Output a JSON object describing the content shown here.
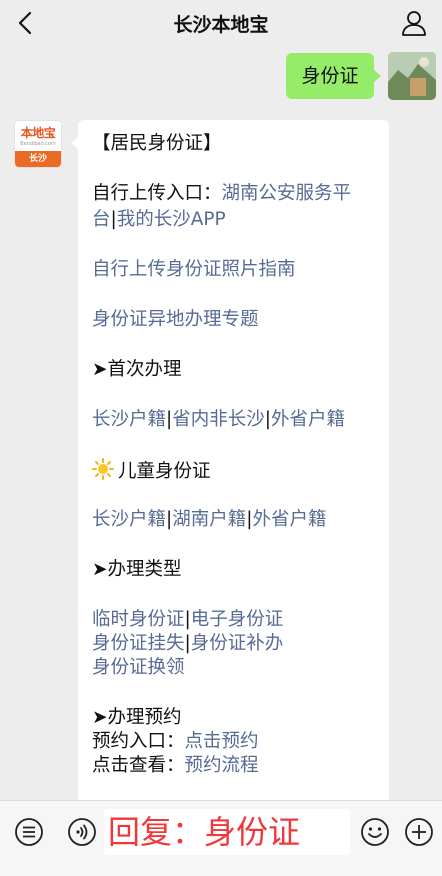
{
  "header": {
    "title": "长沙本地宝",
    "back_icon": "chevron-left-icon",
    "profile_icon": "person-icon"
  },
  "user_message": {
    "text": "身份证",
    "bubble_color": "#95ec69"
  },
  "bot": {
    "logo_text": "本地宝",
    "logo_url": "Bendibao.com",
    "logo_city": "长沙",
    "logo_color": "#ea6a26"
  },
  "bot_message": {
    "heading": "【居民身份证】",
    "upload_label": "自行上传入口：",
    "upload_link_1": "湖南公安服务平",
    "upload_link_2": "台",
    "sep_1": "|",
    "upload_link_3": "我的长沙APP",
    "photo_guide": "自行上传身份证照片指南",
    "remote_topic": "身份证异地办理专题",
    "first_time_heading": "➤首次办理",
    "first_time_links": [
      "长沙户籍",
      "省内非长沙",
      "外省户籍"
    ],
    "children_heading": "儿童身份证",
    "children_links": [
      "长沙户籍",
      "湖南户籍",
      "外省户籍"
    ],
    "types_heading": "➤办理类型",
    "types_row1": [
      "临时身份证",
      "电子身份证"
    ],
    "types_row2": [
      "身份证挂失",
      "身份证补办"
    ],
    "types_row3": [
      "身份证换领"
    ],
    "booking_heading": "➤办理预约",
    "booking_label": "预约入口：",
    "booking_link": "点击预约",
    "view_label": "点击查看：",
    "view_link": "预约流程",
    "link_color": "#576b95"
  },
  "bottom_bar": {
    "reply_tip": "回复：身份证",
    "reply_color": "#f0373a",
    "menu_icon": "menu-list-icon",
    "voice_icon": "voice-icon",
    "emoji_icon": "emoji-icon",
    "plus_icon": "plus-icon"
  }
}
